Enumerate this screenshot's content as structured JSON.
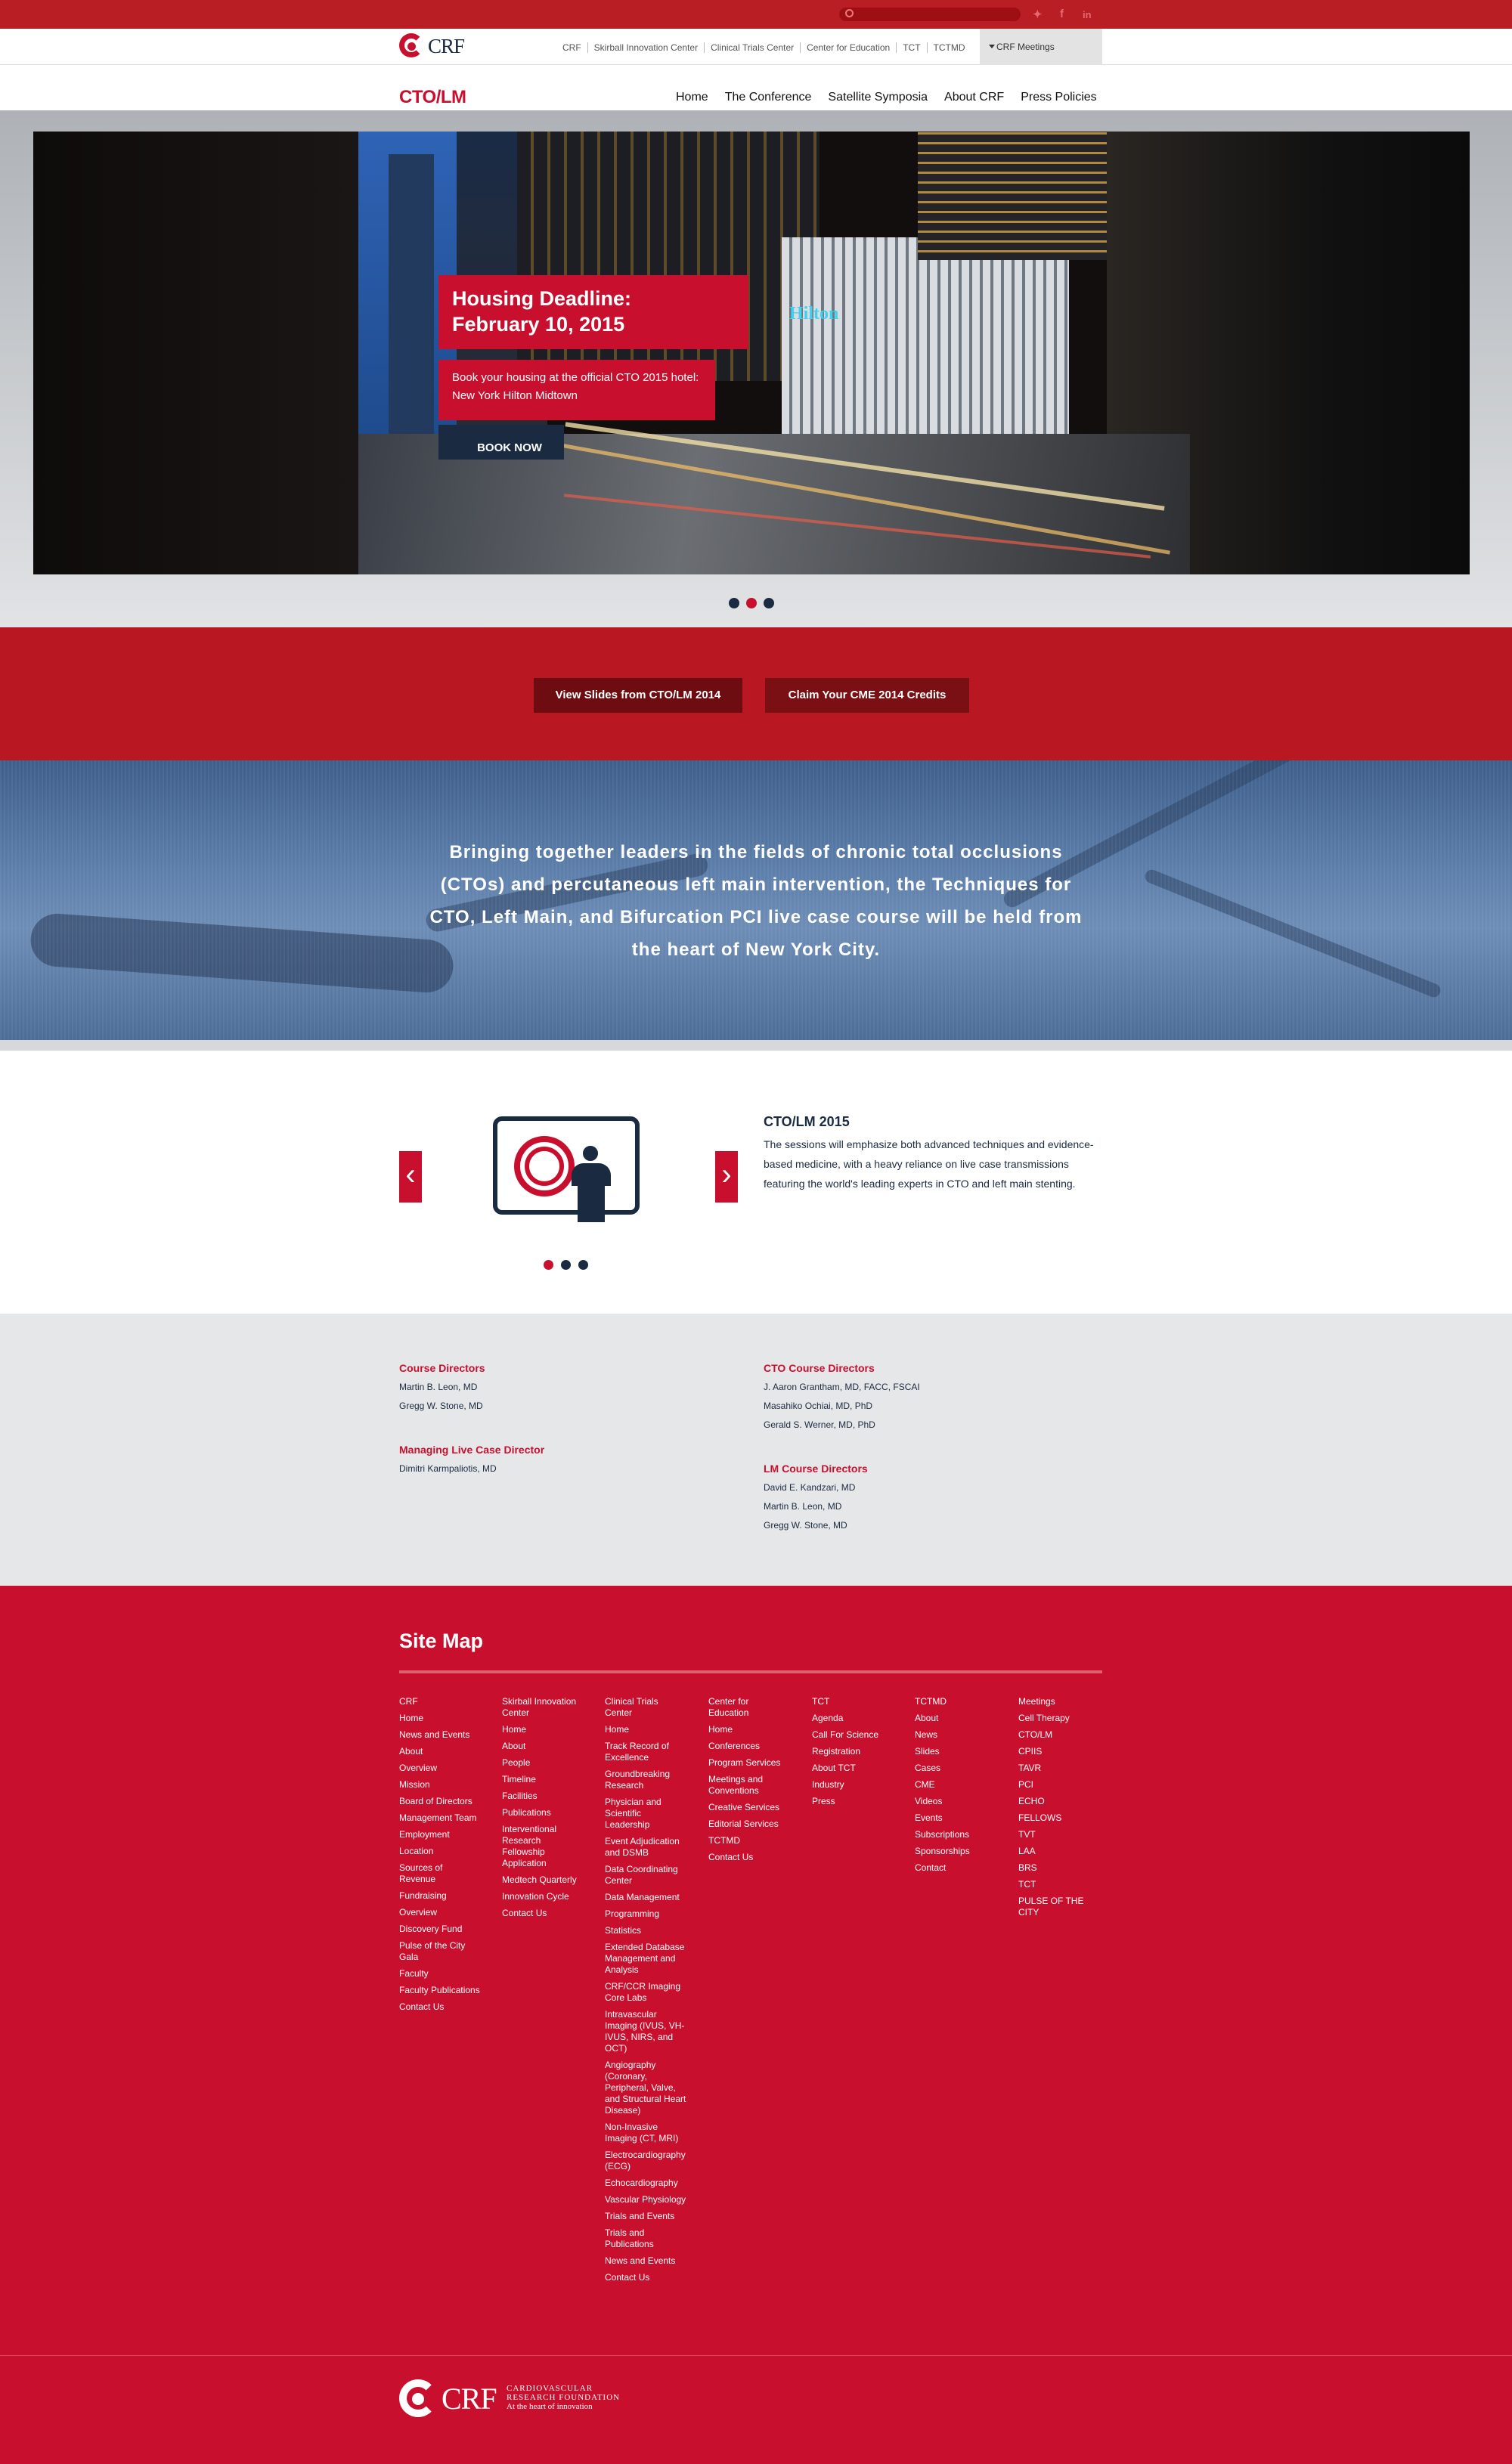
{
  "top": {
    "search_placeholder": "",
    "social": [
      "twitter-icon",
      "facebook-icon",
      "linkedin-icon"
    ]
  },
  "crfnav": {
    "logo": "CRF",
    "links": [
      "CRF",
      "Skirball Innovation Center",
      "Clinical Trials Center",
      "Center for Education",
      "TCT",
      "TCTMD"
    ],
    "meetings": "CRF Meetings"
  },
  "site": {
    "title": "CTO/LM",
    "nav": [
      "Home",
      "The Conference",
      "Satellite Symposia",
      "About CRF",
      "Press Policies"
    ]
  },
  "hero": {
    "headline_1": "Housing Deadline:",
    "headline_2": "February 10, 2015",
    "text_1": "Book your housing at the official CTO 2015 hotel:",
    "text_2": "New York Hilton Midtown",
    "button": "BOOK NOW",
    "sign": "Hilton",
    "active_slide": 2
  },
  "actions": {
    "slides_button": "View Slides from CTO/LM 2014",
    "cme_button": "Claim Your CME 2014 Credits"
  },
  "intro": {
    "text": "Bringing together leaders in the fields of chronic total occlusions (CTOs) and percutaneous left main intervention, the Techniques for CTO, Left Main, and Bifurcation PCI live case course will be held from the heart of New York City."
  },
  "feature": {
    "title": "CTO/LM 2015",
    "description": "The sessions will emphasize both advanced techniques and evidence-based medicine, with a heavy reliance on live case transmissions featuring the world's leading experts in CTO and left main stenting.",
    "active_slide": 1
  },
  "directors": {
    "course_heading": "Course Directors",
    "course": [
      "Martin B. Leon, MD",
      "Gregg W. Stone, MD"
    ],
    "live_heading": "Managing Live Case Director",
    "live": [
      "Dimitri Karmpaliotis, MD"
    ],
    "cto_heading": "CTO Course Directors",
    "cto": [
      "J. Aaron Grantham, MD, FACC, FSCAI",
      "Masahiko Ochiai, MD, PhD",
      "Gerald S. Werner, MD, PhD"
    ],
    "lm_heading": "LM Course Directors",
    "lm": [
      "David E. Kandzari, MD",
      "Martin B. Leon, MD",
      "Gregg W. Stone, MD"
    ]
  },
  "sitemap": {
    "title": "Site Map",
    "columns": [
      [
        "CRF",
        "Home",
        "News and Events",
        "About",
        "Overview",
        "Mission",
        "Board of Directors",
        "Management Team",
        "Employment",
        "Location",
        "Sources of Revenue",
        "Fundraising",
        "Overview",
        "Discovery Fund",
        "Pulse of the City Gala",
        "Faculty",
        "Faculty Publications",
        "Contact Us"
      ],
      [
        "Skirball Innovation Center",
        "Home",
        "About",
        "People",
        "Timeline",
        "Facilities",
        "Publications",
        "Interventional Research Fellowship Application",
        "Medtech Quarterly",
        "Innovation Cycle",
        "Contact Us"
      ],
      [
        "Clinical Trials Center",
        "Home",
        "Track Record of Excellence",
        "Groundbreaking Research",
        "Physician and Scientific Leadership",
        "Event Adjudication and DSMB",
        "Data Coordinating Center",
        "Data Management",
        "Programming",
        "Statistics",
        "Extended Database Management and Analysis",
        "CRF/CCR Imaging Core Labs",
        "Intravascular Imaging (IVUS, VH-IVUS, NIRS, and OCT)",
        "Angiography (Coronary, Peripheral, Valve, and Structural Heart Disease)",
        "Non-Invasive Imaging (CT, MRI)",
        "Electrocardiography (ECG)",
        "Echocardiography",
        "Vascular Physiology",
        "Trials and Events",
        "Trials and Publications",
        "News and Events",
        "Contact Us"
      ],
      [
        "Center for Education",
        "Home",
        "Conferences",
        "Program Services",
        "Meetings and Conventions",
        "Creative Services",
        "Editorial Services",
        "TCTMD",
        "Contact Us"
      ],
      [
        "TCT",
        "Agenda",
        "Call For Science",
        "Registration",
        "About TCT",
        "Industry",
        "Press"
      ],
      [
        "TCTMD",
        "About",
        "News",
        "Slides",
        "Cases",
        "CME",
        "Videos",
        "Events",
        "Subscriptions",
        "Sponsorships",
        "Contact"
      ],
      [
        "Meetings",
        "Cell Therapy",
        "CTO/LM",
        "CPIIS",
        "TAVR",
        "PCI",
        "ECHO",
        "FELLOWS",
        "TVT",
        "LAA",
        "BRS",
        "TCT",
        "PULSE OF THE CITY"
      ]
    ]
  },
  "footer": {
    "logo": "CRF",
    "org_1": "CARDIOVASCULAR",
    "org_2": "RESEARCH FOUNDATION",
    "tagline": "At the heart of innovation"
  }
}
